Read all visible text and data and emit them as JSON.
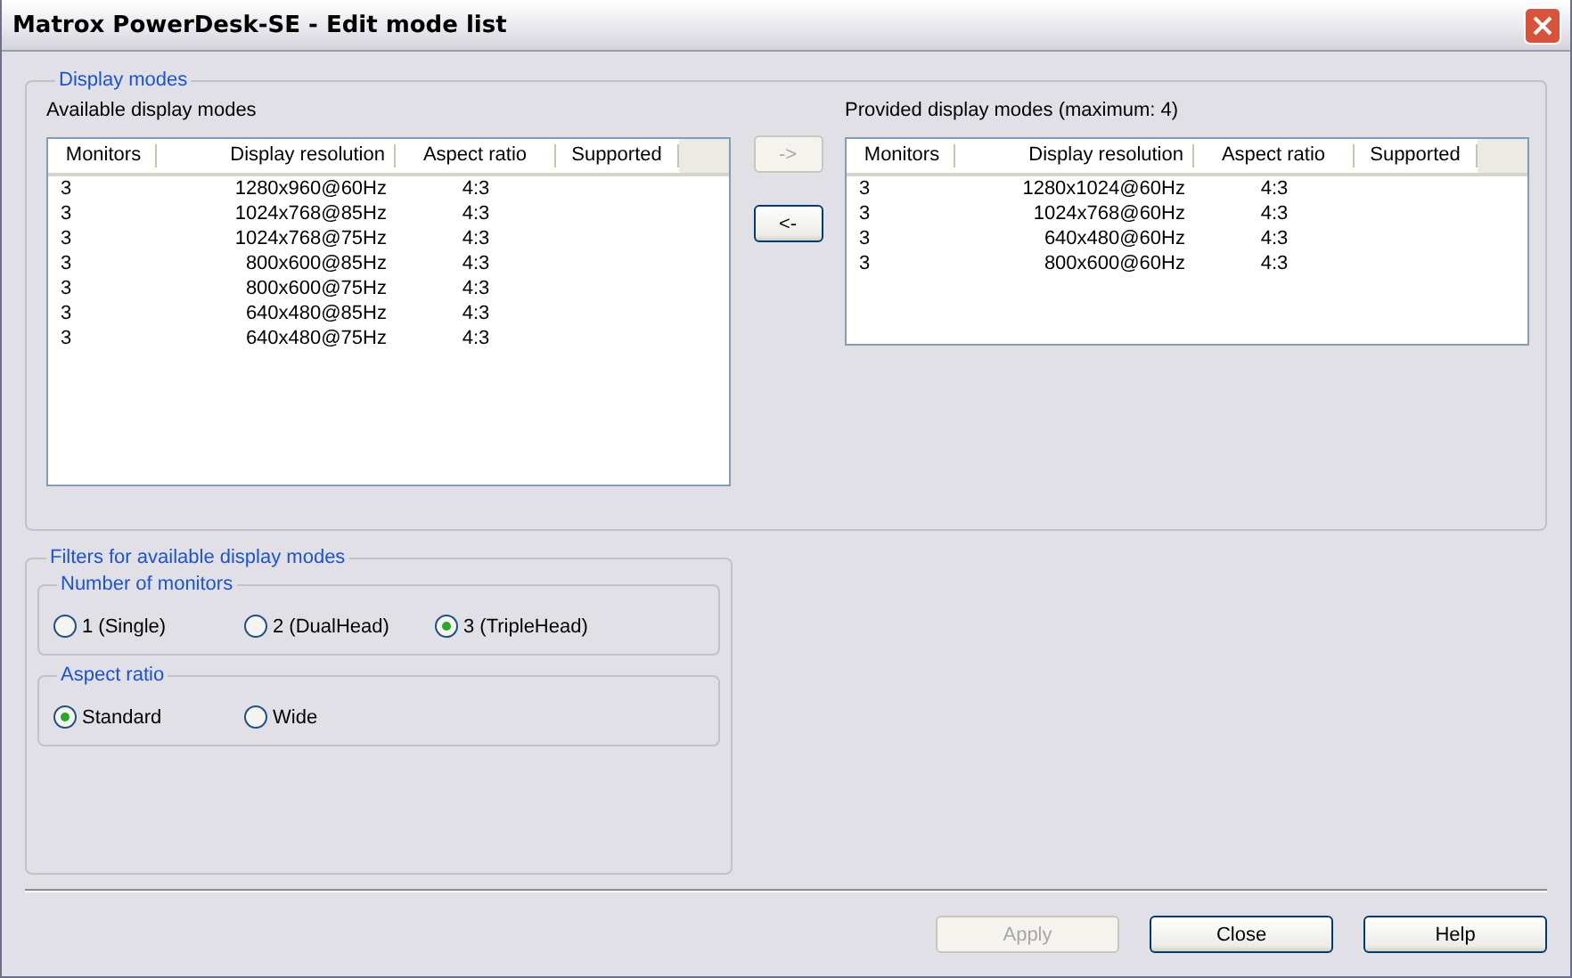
{
  "window": {
    "title": "Matrox PowerDesk-SE - Edit mode list"
  },
  "display_modes": {
    "title": "Display modes",
    "available": {
      "label": "Available display modes",
      "columns": [
        "Monitors",
        "Display resolution",
        "Aspect ratio",
        "Supported"
      ],
      "rows": [
        [
          "3",
          "1280x960@60Hz",
          "4:3"
        ],
        [
          "3",
          "1024x768@85Hz",
          "4:3"
        ],
        [
          "3",
          "1024x768@75Hz",
          "4:3"
        ],
        [
          "3",
          "800x600@85Hz",
          "4:3"
        ],
        [
          "3",
          "800x600@75Hz",
          "4:3"
        ],
        [
          "3",
          "640x480@85Hz",
          "4:3"
        ],
        [
          "3",
          "640x480@75Hz",
          "4:3"
        ]
      ]
    },
    "move_buttons": [
      {
        "label": "->",
        "disabled": true
      },
      {
        "label": "<-",
        "disabled": false
      }
    ],
    "provided": {
      "label": "Provided display modes (maximum: 4)",
      "columns": [
        "Monitors",
        "Display resolution",
        "Aspect ratio",
        "Supported"
      ],
      "rows": [
        [
          "3",
          "1280x1024@60Hz",
          "4:3"
        ],
        [
          "3",
          "1024x768@60Hz",
          "4:3"
        ],
        [
          "3",
          "640x480@60Hz",
          "4:3"
        ],
        [
          "3",
          "800x600@60Hz",
          "4:3"
        ]
      ]
    }
  },
  "filters": {
    "title": "Filters for available display modes",
    "groups": [
      {
        "title": "Number of monitors",
        "options": [
          {
            "label": "1 (Single)",
            "selected": false
          },
          {
            "label": "2 (DualHead)",
            "selected": false
          },
          {
            "label": "3 (TripleHead)",
            "selected": true
          }
        ]
      },
      {
        "title": "Aspect ratio",
        "options": [
          {
            "label": "Standard",
            "selected": true
          },
          {
            "label": "Wide",
            "selected": false
          }
        ]
      }
    ]
  },
  "buttons": [
    {
      "label": "Apply",
      "disabled": true
    },
    {
      "label": "Close",
      "disabled": false
    },
    {
      "label": "Help",
      "disabled": false
    }
  ]
}
